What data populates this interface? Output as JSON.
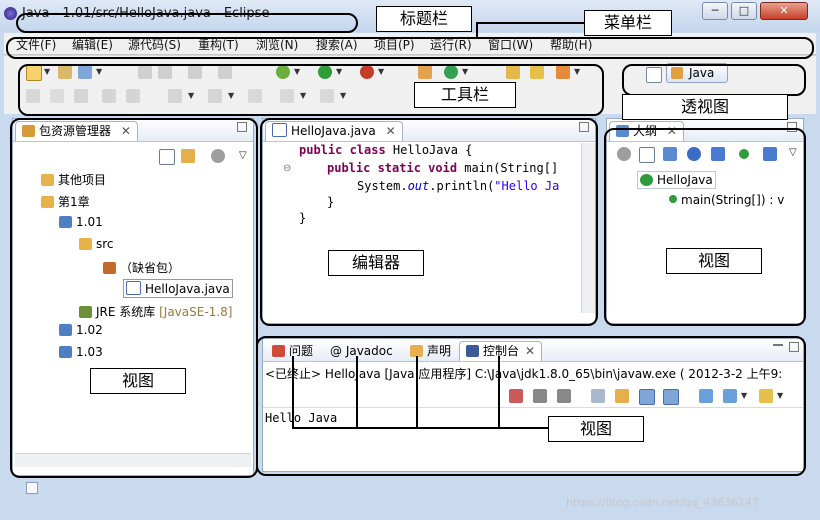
{
  "window": {
    "title": "Java  -  1.01/src/HelloJava.java  -  Eclipse",
    "minimize": "─",
    "maximize": "□",
    "close": "✕"
  },
  "menu": [
    "文件(F)",
    "编辑(E)",
    "源代码(S)",
    "重构(T)",
    "浏览(N)",
    "搜索(A)",
    "项目(P)",
    "运行(R)",
    "窗口(W)",
    "帮助(H)"
  ],
  "perspective": {
    "label": "Java"
  },
  "package_explorer": {
    "tab": "包资源管理器",
    "items": [
      {
        "label": "其他项目",
        "extra": ""
      },
      {
        "label": "第1章",
        "extra": ""
      },
      {
        "label": "1.01",
        "extra": ""
      },
      {
        "label": "src",
        "extra": ""
      },
      {
        "label": "（缺省包）",
        "extra": ""
      },
      {
        "label": "HelloJava.java",
        "extra": ""
      },
      {
        "label": "JRE 系统库",
        "extra": "[JavaSE-1.8]"
      },
      {
        "label": "1.02",
        "extra": ""
      },
      {
        "label": "1.03",
        "extra": ""
      }
    ]
  },
  "editor": {
    "tab": "HelloJava.java",
    "lines": [
      {
        "kw": "public class",
        "rest": " HelloJava {"
      },
      {
        "kw": "public static void",
        "rest": " main(String[]"
      },
      {
        "pre": "System.",
        "ital": "out",
        "mid": ".println(",
        "str": "\"Hello Ja"
      },
      {
        "rest": "}"
      },
      {
        "rest": "}"
      }
    ]
  },
  "outline": {
    "tab": "大纲",
    "class_name": "HelloJava",
    "method": "main(String[]) : v"
  },
  "bottom": {
    "tabs": [
      "问题",
      "@ Javadoc",
      "声明",
      "控制台"
    ],
    "status": "<已终止> HelloJava [Java 应用程序] C:\\Java\\jdk1.8.0_65\\bin\\javaw.exe ( 2012-3-2 上午9:",
    "output": "Hello Java"
  },
  "annotations": {
    "title_bar": "标题栏",
    "menu_bar": "菜单栏",
    "toolbar": "工具栏",
    "perspective": "透视图",
    "editor": "编辑器",
    "view_left": "视图",
    "view_right": "视图",
    "view_bottom": "视图"
  },
  "watermark": "https://blog.csdn.net/qq_43636147"
}
